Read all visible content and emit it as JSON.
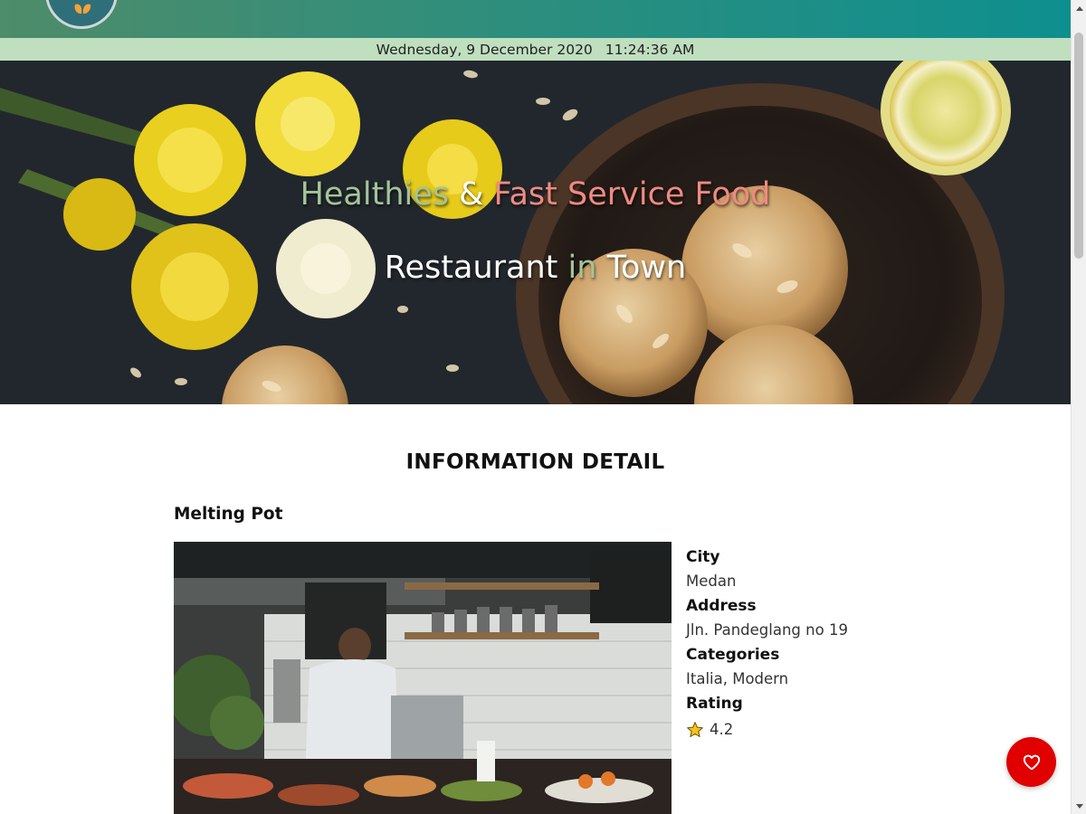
{
  "header": {
    "logo_icon": "butterfly-logo-icon"
  },
  "datetime": {
    "date": "Wednesday, 9 December 2020",
    "time": "11:24:36 AM"
  },
  "hero": {
    "line1": {
      "part1": "Healthies",
      "part2": " & ",
      "part3": "Fast Service Food"
    },
    "line2": {
      "part1": "Restaurant ",
      "part2": "in",
      "part3": " Town"
    }
  },
  "detail": {
    "section_title": "INFORMATION DETAIL",
    "restaurant_name": "Melting Pot",
    "fields": {
      "city_label": "City",
      "city_value": "Medan",
      "address_label": "Address",
      "address_value": "Jln. Pandeglang no 19",
      "categories_label": "Categories",
      "categories_value": "Italia, Modern",
      "rating_label": "Rating",
      "rating_value": "4.2"
    }
  },
  "actions": {
    "favorite_icon": "heart-icon"
  },
  "colors": {
    "accent_green": "#a3c59a",
    "accent_red": "#f08a80",
    "date_bar": "#bfdfbf",
    "favorite_button": "#e00000"
  }
}
